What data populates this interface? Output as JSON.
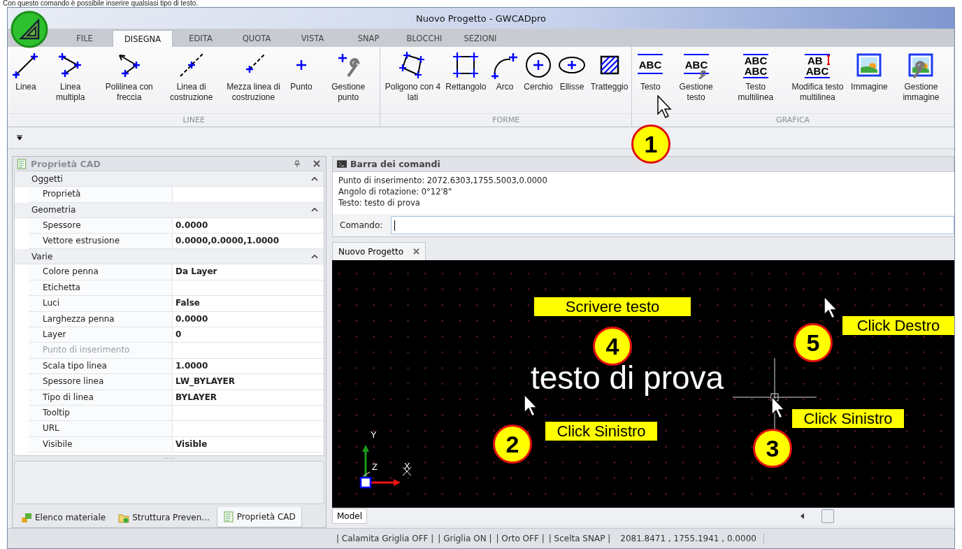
{
  "caption": "Con questo comando è possibile inserire qualsiasi tipo di testo.",
  "window": {
    "title": "Nuovo Progetto - GWCADpro"
  },
  "ribbon_tabs": [
    {
      "label": "FILE",
      "selected": false
    },
    {
      "label": "DISEGNA",
      "selected": true
    },
    {
      "label": "EDITA",
      "selected": false
    },
    {
      "label": "QUOTA",
      "selected": false
    },
    {
      "label": "VISTA",
      "selected": false
    },
    {
      "label": "SNAP",
      "selected": false
    },
    {
      "label": "BLOCCHI",
      "selected": false
    },
    {
      "label": "SEZIONI",
      "selected": false
    }
  ],
  "ribbon_groups": [
    {
      "title": "LINEE",
      "tools": [
        {
          "label": "Linea",
          "kind": "line"
        },
        {
          "label": "Linea multipla",
          "kind": "multiline"
        },
        {
          "label": "Polilinea con freccia",
          "kind": "polyarrow"
        },
        {
          "label": "Linea di costruzione",
          "kind": "xline"
        },
        {
          "label": "Mezza linea di costruzione",
          "kind": "ray"
        },
        {
          "label": "Punto",
          "kind": "point"
        },
        {
          "label": "Gestione punto",
          "kind": "pointtool"
        }
      ]
    },
    {
      "title": "FORME",
      "tools": [
        {
          "label": "Poligono con 4 lati",
          "kind": "polygon"
        },
        {
          "label": "Rettangolo",
          "kind": "rect"
        },
        {
          "label": "Arco",
          "kind": "arc"
        },
        {
          "label": "Cerchio",
          "kind": "circle"
        },
        {
          "label": "Ellisse",
          "kind": "ellipse"
        },
        {
          "label": "Tratteggio",
          "kind": "hatch"
        }
      ]
    },
    {
      "title": "GRAFICA",
      "tools": [
        {
          "label": "Testo",
          "kind": "text",
          "glyphs": [
            "ABC"
          ]
        },
        {
          "label": "Gestione testo",
          "kind": "texttool",
          "glyphs": [
            "ABC"
          ]
        },
        {
          "label": "Testo multilinea",
          "kind": "mtext",
          "glyphs": [
            "ABC",
            "ABC"
          ]
        },
        {
          "label": "Modifica testo multilinea",
          "kind": "mtextedit",
          "glyphs": [
            "AB",
            "ABC"
          ]
        },
        {
          "label": "Immagine",
          "kind": "image"
        },
        {
          "label": "Gestione immagine",
          "kind": "imagetool"
        }
      ]
    }
  ],
  "properties_panel": {
    "title": "Proprietà CAD",
    "categories": [
      {
        "name": "Oggetti",
        "expanded": true,
        "properties": [
          {
            "name": "Proprietà",
            "disabled": false
          }
        ]
      },
      {
        "name": "Geometria",
        "expanded": true,
        "properties": [
          {
            "name": "Spessore",
            "value": "0.0000",
            "disabled": false
          },
          {
            "name": "Vettore estrusione",
            "value": "0.0000,0.0000,1.0000",
            "disabled": false
          }
        ]
      },
      {
        "name": "Varie",
        "expanded": true,
        "properties": [
          {
            "name": "Colore penna",
            "value": "Da Layer",
            "disabled": false
          },
          {
            "name": "Etichetta",
            "disabled": false
          },
          {
            "name": "Luci",
            "value": "False",
            "disabled": false
          },
          {
            "name": "Larghezza penna",
            "value": "0.0000",
            "disabled": false
          },
          {
            "name": "Layer",
            "value": "0",
            "disabled": false
          },
          {
            "name": "Punto di inserimento",
            "disabled": true
          },
          {
            "name": "Scala tipo linea",
            "value": "1.0000",
            "disabled": false
          },
          {
            "name": "Spessore linea",
            "value": "LW_BYLAYER",
            "disabled": false
          },
          {
            "name": "Tipo di linea",
            "value": "BYLAYER",
            "disabled": false
          },
          {
            "name": "Tooltip",
            "disabled": false
          },
          {
            "name": "URL",
            "disabled": false
          },
          {
            "name": "Visibile",
            "value": "Visible",
            "disabled": false
          }
        ]
      }
    ]
  },
  "panel_tabs": [
    {
      "label": "Elenco materiale",
      "kind": "material",
      "selected": false
    },
    {
      "label": "Struttura Preven...",
      "kind": "folder",
      "selected": false
    },
    {
      "label": "Proprietà CAD",
      "kind": "properties",
      "selected": true
    }
  ],
  "command_bar": {
    "title": "Barra dei comandi",
    "history": [
      "Punto di inserimento: 2072.6303,1755.5003,0.0000",
      "Angolo di rotazione: 0°12'8\"",
      "Testo: testo di prova"
    ],
    "prompt": "Comando:"
  },
  "document_tabs": [
    {
      "label": "Nuovo Progetto",
      "selected": true
    }
  ],
  "canvas": {
    "text": "testo di prova",
    "ucs": {
      "y": "Y",
      "z": "Z",
      "x": "X"
    },
    "labels": [
      "Scrivere testo",
      "Click Sinistro",
      "Click Sinistro",
      "Click Destro"
    ],
    "markers": [
      "1",
      "2",
      "3",
      "4",
      "5"
    ]
  },
  "layout_tabs": [
    {
      "label": "Model",
      "selected": true
    }
  ],
  "status_bar": {
    "items": [
      "| Calamita Griglia OFF |",
      "| Griglia ON |",
      "| Orto OFF |",
      "| Scelta SNAP |"
    ],
    "coordinates": "2081.8471 , 1755.1941 , 0.0000"
  }
}
